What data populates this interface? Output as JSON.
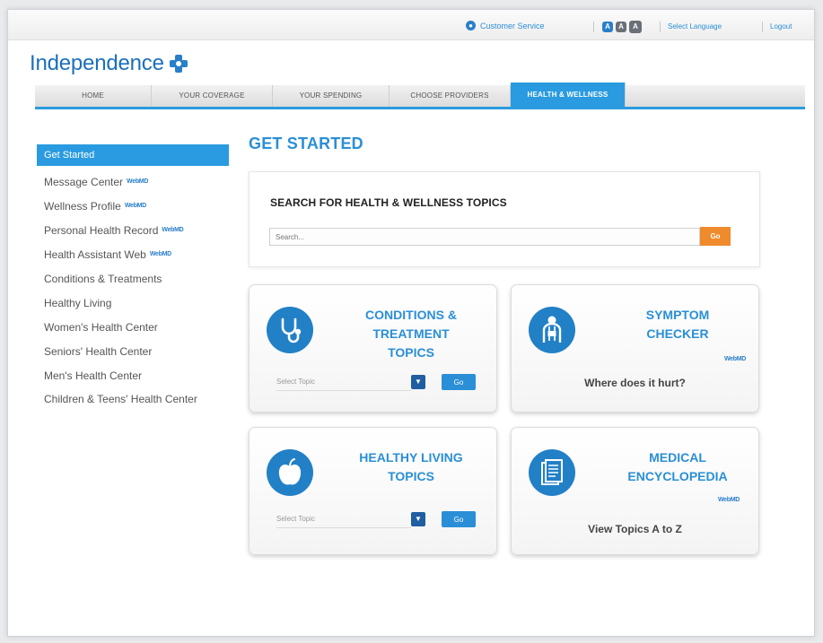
{
  "header": {
    "customer_service": "Customer Service",
    "text_size_buttons": [
      "A",
      "A",
      "A"
    ],
    "select_language": "Select Language",
    "logout": "Logout"
  },
  "brand": {
    "logo_text": "Independence",
    "accent": "#2a9be0",
    "logo_color": "#1c6fbd"
  },
  "nav": {
    "tabs": [
      {
        "label": "HOME"
      },
      {
        "label": "YOUR COVERAGE"
      },
      {
        "label": "YOUR SPENDING"
      },
      {
        "label": "CHOOSE PROVIDERS"
      },
      {
        "label": "HEALTH & WELLNESS",
        "active": true
      }
    ]
  },
  "sidebar": {
    "items": [
      {
        "label": "Get Started",
        "active": true
      },
      {
        "label": "Message Center",
        "webmd": true
      },
      {
        "label": "Wellness Profile",
        "webmd": true
      },
      {
        "label": "Personal Health Record",
        "webmd": true
      },
      {
        "label": "Health Assistant Web",
        "webmd": true
      },
      {
        "label": "Conditions & Treatments"
      },
      {
        "label": "Healthy Living"
      },
      {
        "label": "Women's Health Center"
      },
      {
        "label": "Seniors' Health Center"
      },
      {
        "label": "Men's Health Center"
      },
      {
        "label": "Children & Teens' Health Center"
      }
    ],
    "webmd_label": "WebMD"
  },
  "main": {
    "title": "GET STARTED",
    "search": {
      "heading": "SEARCH FOR HEALTH & WELLNESS TOPICS",
      "placeholder": "Search...",
      "go": "Go"
    },
    "cards": {
      "conditions": {
        "title_lines": [
          "CONDITIONS &",
          "TREATMENT",
          "TOPICS"
        ],
        "select_placeholder": "Select Topic",
        "go": "Go"
      },
      "symptom": {
        "title_lines": [
          "SYMPTOM",
          "CHECKER"
        ],
        "subtitle": "Where does it hurt?"
      },
      "healthy_living": {
        "title_lines": [
          "HEALTHY LIVING",
          "TOPICS"
        ],
        "select_placeholder": "Select Topic",
        "go": "Go"
      },
      "encyclopedia": {
        "title_lines": [
          "MEDICAL",
          "ENCYCLOPEDIA"
        ],
        "subtitle": "View Topics A to Z"
      }
    }
  }
}
